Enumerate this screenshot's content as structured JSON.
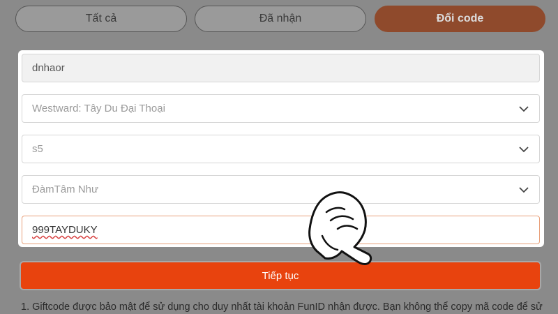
{
  "tabs": [
    {
      "label": "Tất cả"
    },
    {
      "label": "Đã nhận"
    },
    {
      "label": "Đổi code"
    }
  ],
  "form": {
    "account_value": "dnhaor",
    "game_value": "Westward: Tây Du Đại Thoại",
    "server_value": "s5",
    "character_value": "ĐàmTâm Như",
    "code_value": "999TAYDUKY"
  },
  "submit_label": "Tiếp tục",
  "notes": [
    "1. Giftcode được bảo mật để sử dụng cho duy nhất tài khoản FunID nhận được. Bạn không thể copy mã code để sử"
  ],
  "icons": {
    "dropdown": "chevron-down-icon",
    "pointer": "hand-pointer-icon"
  },
  "colors": {
    "accent": "#e8430e",
    "active_tab": "#8f4a2c",
    "overlay": "#8a8a8a"
  }
}
